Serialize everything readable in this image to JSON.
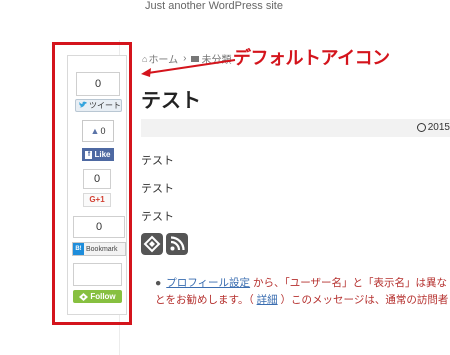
{
  "site": {
    "tagline": "Just another WordPress site"
  },
  "breadcrumb": {
    "home": "ホーム",
    "separator": "›",
    "category": "未分類"
  },
  "annotation": {
    "callout": "デフォルトアイコン",
    "color": "#d4141c"
  },
  "post": {
    "title": "テスト",
    "date": "2015",
    "paragraphs": [
      "テスト",
      "テスト",
      "テスト"
    ]
  },
  "share": {
    "twitter": {
      "count": "0",
      "label": "ツイート"
    },
    "facebook": {
      "count": "0",
      "label": "Like"
    },
    "google": {
      "count": "0",
      "label": "G+1"
    },
    "hatena": {
      "count": "0",
      "label": "Bookmark",
      "mark": "B!"
    },
    "feedly": {
      "count": "",
      "label": "Follow"
    }
  },
  "footer_icons": [
    "feedly-icon",
    "rss-icon"
  ],
  "notice": {
    "link1": "プロフィール設定",
    "text1": "から、「ユーザー名」と「表示名」は異な",
    "text2": "とをお勧めします。（",
    "link2": "詳細",
    "text3": "）このメッセージは、通常の訪問者"
  }
}
